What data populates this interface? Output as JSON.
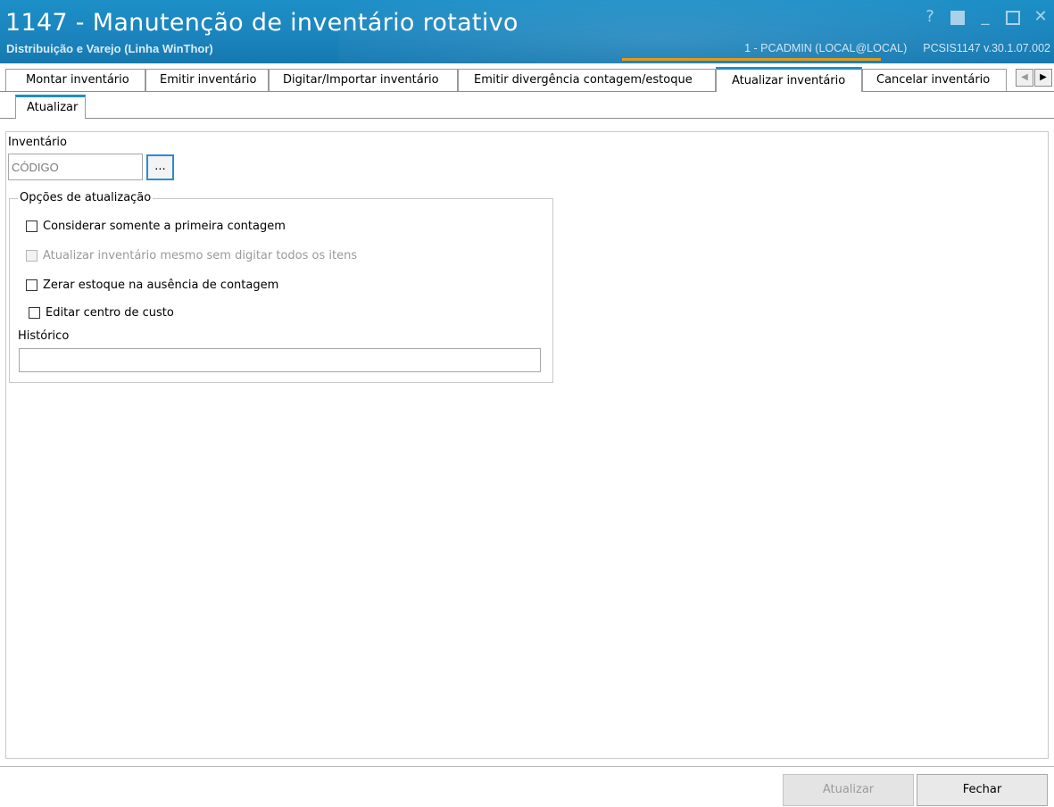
{
  "window": {
    "title": "1147 - Manutenção de inventário rotativo",
    "subtitle": "Distribuição e Varejo (Linha WinThor)",
    "user_info": "1 - PCADMIN (LOCAL@LOCAL)",
    "program_info": "PCSIS1147  v.30.1.07.002",
    "controls": {
      "help": "?",
      "minimize": "_",
      "close": "✕"
    }
  },
  "tabs": [
    {
      "label": "Montar inventário"
    },
    {
      "label": "Emitir inventário"
    },
    {
      "label": "Digitar/Importar inventário"
    },
    {
      "label": "Emitir divergência contagem/estoque"
    },
    {
      "label": "Atualizar inventário",
      "active": true
    },
    {
      "label": "Cancelar inventário"
    }
  ],
  "tab_scroll": {
    "left": "◀",
    "right": "▶"
  },
  "subtabs": [
    {
      "label": "Atualizar",
      "active": true
    }
  ],
  "form": {
    "inventario_label": "Inventário",
    "inventario_placeholder": "CÓDIGO",
    "inventario_value": "",
    "browse_label": "...",
    "options_group_label": "Opções de atualização",
    "options": [
      {
        "label": "Considerar somente a primeira contagem",
        "checked": false,
        "enabled": true
      },
      {
        "label": "Atualizar inventário mesmo sem digitar todos os itens",
        "checked": false,
        "enabled": false
      },
      {
        "label": "Zerar estoque na ausência de contagem",
        "checked": false,
        "enabled": true
      },
      {
        "label": "Editar centro de custo",
        "checked": false,
        "enabled": true
      }
    ],
    "historico_label": "Histórico",
    "historico_value": ""
  },
  "footer": {
    "update_button": "Atualizar",
    "update_enabled": false,
    "close_button": "Fechar"
  },
  "colors": {
    "title_bar": "#1b84bd",
    "accent": "#1d8fc7",
    "highlight": "#e29b1c"
  }
}
